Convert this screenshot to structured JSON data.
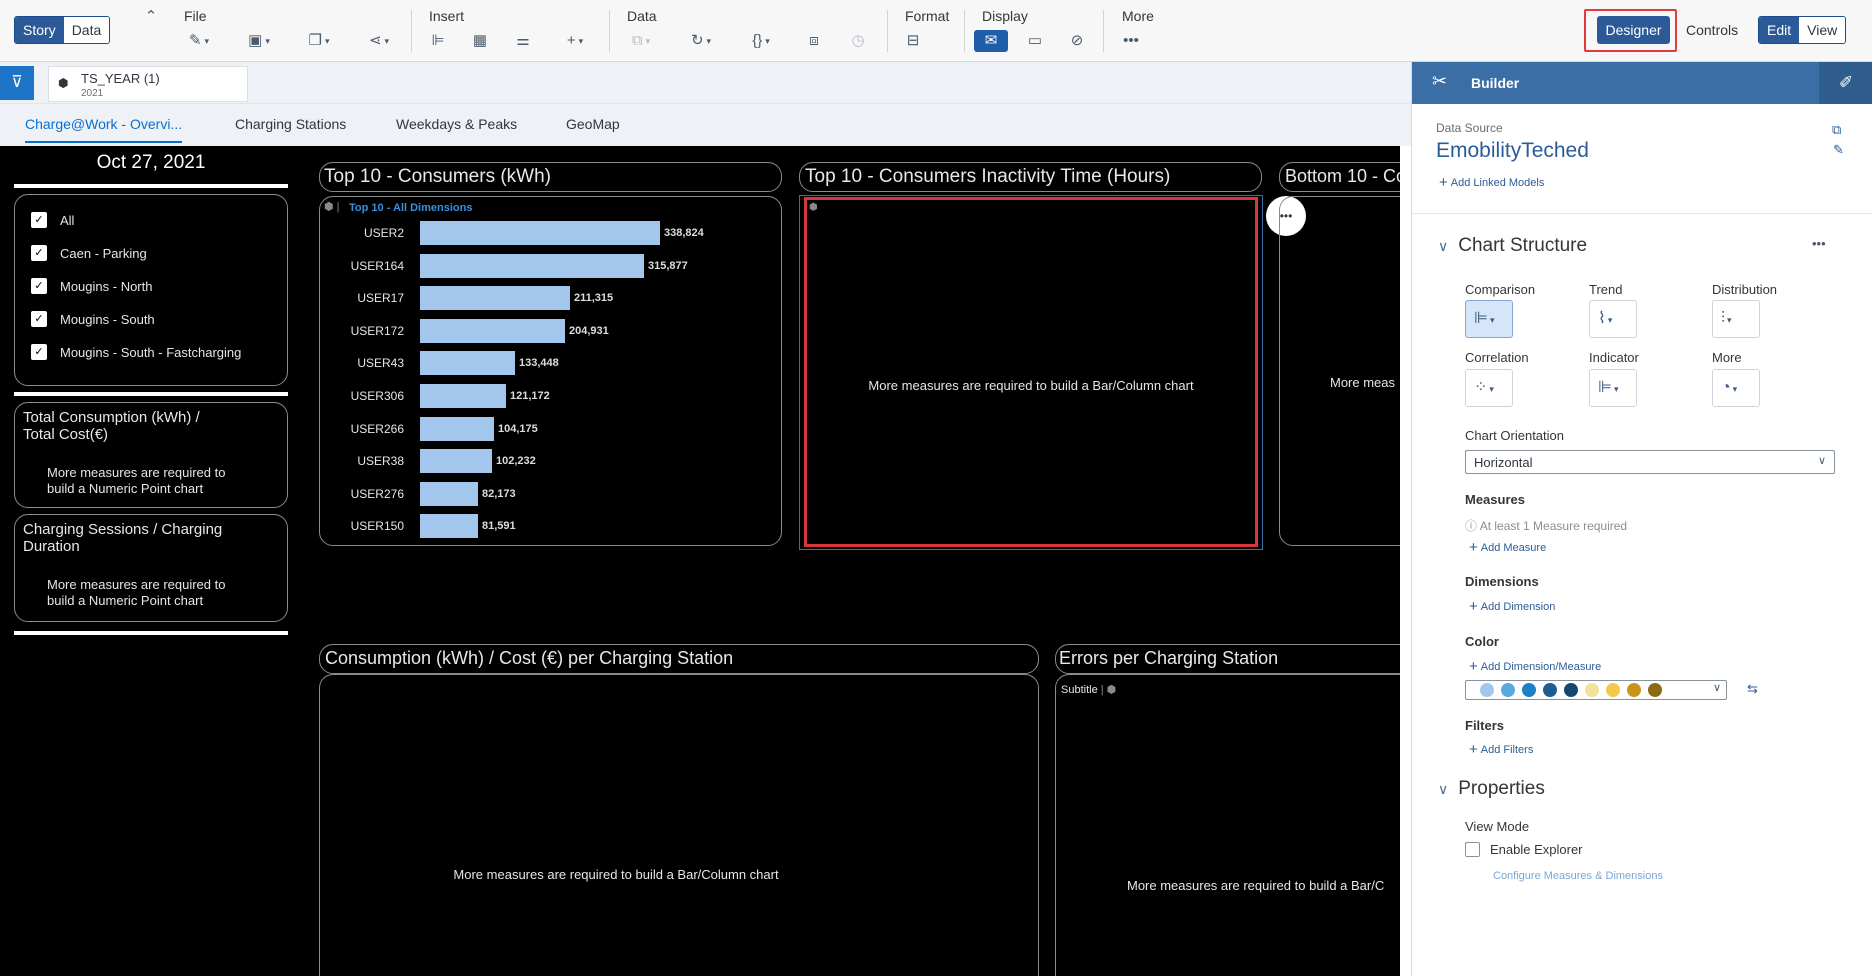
{
  "toolbar": {
    "story_label": "Story",
    "data_label": "Data",
    "groups": [
      "File",
      "Insert",
      "Data",
      "Format",
      "Display",
      "More"
    ],
    "designer_label": "Designer",
    "controls_label": "Controls",
    "edit_label": "Edit",
    "view_label": "View"
  },
  "filter": {
    "name": "TS_YEAR (1)",
    "value": "2021"
  },
  "tabs": [
    "Charge@Work - Overvi...",
    "Charging Stations",
    "Weekdays & Peaks",
    "GeoMap"
  ],
  "canvas": {
    "date": "Oct 27, 2021",
    "checkboxes": [
      "All",
      "Caen - Parking",
      "Mougins - North",
      "Mougins - South",
      "Mougins - South - Fastcharging"
    ],
    "kpi1": {
      "title_line1": "Total Consumption (kWh) /",
      "title_line2": "Total Cost(€)",
      "msg_line1": "More measures are required to",
      "msg_line2": "build a Numeric Point chart"
    },
    "kpi2": {
      "title_line1": "Charging Sessions / Charging",
      "title_line2": "Duration",
      "msg_line1": "More measures are required to",
      "msg_line2": "build a Numeric Point chart"
    },
    "chart1": {
      "title": "Top 10 - Consumers (kWh)",
      "subtitle": "Top 10 - All Dimensions"
    },
    "chart2": {
      "title": "Top 10 - Consumers Inactivity Time (Hours)",
      "msg": "More measures are required to build a Bar/Column chart"
    },
    "chart3": {
      "title": "Bottom 10 - Co",
      "msg": "More meas"
    },
    "chart4": {
      "title": "Consumption (kWh) / Cost (€) per Charging Station",
      "msg": "More measures are required to build a Bar/Column chart"
    },
    "chart5": {
      "title": "Errors per Charging Station",
      "subtitle": "Subtitle",
      "msg": "More measures are required to build a Bar/C"
    }
  },
  "chart_data": {
    "type": "bar",
    "title": "Top 10 - Consumers (kWh)",
    "subtitle": "Top 10 - All Dimensions",
    "orientation": "horizontal",
    "categories": [
      "USER2",
      "USER164",
      "USER17",
      "USER172",
      "USER43",
      "USER306",
      "USER266",
      "USER38",
      "USER276",
      "USER150"
    ],
    "values": [
      338824,
      315877,
      211315,
      204931,
      133448,
      121172,
      104175,
      102232,
      82173,
      81591
    ],
    "labels": [
      "338,824",
      "315,877",
      "211,315",
      "204,931",
      "133,448",
      "121,172",
      "104,175",
      "102,232",
      "82,173",
      "81,591"
    ],
    "color": "#a3c7ec"
  },
  "builder": {
    "title": "Builder",
    "data_source_label": "Data Source",
    "data_source_name": "EmobilityTeched",
    "add_linked_models": "Add Linked Models",
    "chart_structure": "Chart Structure",
    "chart_types": [
      "Comparison",
      "Trend",
      "Distribution",
      "Correlation",
      "Indicator",
      "More"
    ],
    "orientation_label": "Chart Orientation",
    "orientation_value": "Horizontal",
    "measures_label": "Measures",
    "measures_warning": "At least 1 Measure required",
    "add_measure": "Add Measure",
    "dimensions_label": "Dimensions",
    "add_dimension": "Add Dimension",
    "color_label": "Color",
    "add_dimension_measure": "Add Dimension/Measure",
    "palette": [
      "#a3c7ec",
      "#5aa8e0",
      "#1f7fc4",
      "#1c5d93",
      "#15486e",
      "#f2e29c",
      "#f2c94c",
      "#c9961a",
      "#8c6a12"
    ],
    "filters_label": "Filters",
    "add_filters": "Add Filters",
    "properties": "Properties",
    "view_mode_label": "View Mode",
    "enable_explorer": "Enable Explorer",
    "configure_link": "Configure Measures & Dimensions"
  }
}
